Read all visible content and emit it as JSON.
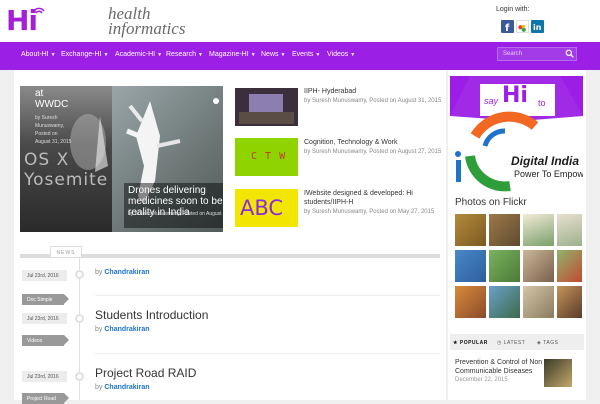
{
  "header": {
    "logo_text": "Hi",
    "tagline_line1": "health",
    "tagline_line2": "informatics",
    "login_label": "Login with:",
    "social": [
      "facebook-icon",
      "google-icon",
      "linkedin-icon"
    ],
    "brand_color": "#9c1fe6"
  },
  "nav": {
    "items": [
      {
        "label": "About-HI"
      },
      {
        "label": "Exchange-HI"
      },
      {
        "label": "Academic-HI"
      },
      {
        "label": "Research"
      },
      {
        "label": "Magazine-HI"
      },
      {
        "label": "News"
      },
      {
        "label": "Events"
      },
      {
        "label": "Videos"
      }
    ],
    "search_placeholder": "Search"
  },
  "featured": {
    "left": {
      "title_line1": "at",
      "title_line2": "WWDC",
      "meta_lines": [
        "by Suresh",
        "Munuswamy,",
        "Posted on",
        "August 31, 2015"
      ],
      "overlay": "OS X Yosemite"
    },
    "drone": {
      "title": "Drones delivering medicines soon to be a reality in India",
      "meta": "by Suresh Munuswamy, Posted on August"
    }
  },
  "posts": [
    {
      "title": "IIPH- Hyderabad",
      "meta": "by Suresh Munuswamy, Posted on August 31, 2015"
    },
    {
      "title": "Cognition, Technology & Work",
      "meta": "by Suresh Munuswamy, Posted on August 27, 2015"
    },
    {
      "title": "IWebsite designed & developed: Hi students/IIPH-H",
      "meta": "by Suresh Munuswamy, Posted on May 27, 2015"
    }
  ],
  "thumb_labels": {
    "ctw": "C T W",
    "abc": "ABC"
  },
  "news": {
    "label": "NEWS",
    "entries": [
      {
        "date": "Jul 23rd, 2016",
        "category": "Doc Simple",
        "by": "by",
        "author": "Chandrakiran",
        "title": ""
      },
      {
        "date": "Jul 23rd, 2016",
        "category": "Videos",
        "by": "by",
        "author": "Chandrakiran",
        "title": "Students Introduction"
      },
      {
        "date": "Jul 23rd, 2016",
        "category": "Project Road",
        "by": "by",
        "author": "Chandrakiran",
        "title": "Project Road RAID"
      }
    ]
  },
  "promo": {
    "say": "say",
    "hi": "Hi",
    "to": "to",
    "digital": "Digital India",
    "power": "Power To Empower"
  },
  "flickr": {
    "title": "Photos on Flickr"
  },
  "sidebar_tabs": {
    "popular": "POPULAR",
    "latest": "LATEST",
    "tags": "TAGS"
  },
  "sidebar_post": {
    "title": "Prevention & Control of Non Communicable Diseases",
    "date": "December 22, 2015"
  }
}
